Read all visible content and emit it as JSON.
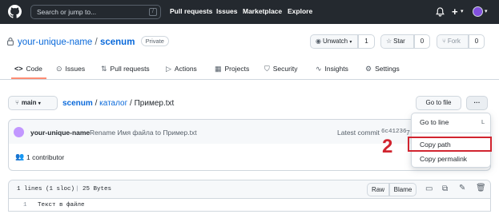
{
  "topbar": {
    "search_placeholder": "Search or jump to...",
    "search_shortcut": "/",
    "nav": [
      "Pull requests",
      "Issues",
      "Marketplace",
      "Explore"
    ],
    "plus": "+",
    "caret": "▾"
  },
  "repo": {
    "owner": "your-unique-name",
    "separator": "/",
    "name": "scenum",
    "visibility": "Private",
    "unwatch_label": "Unwatch",
    "watch_count": "1",
    "star_label": "Star",
    "star_count": "0",
    "fork_label": "Fork",
    "fork_count": "0"
  },
  "tabs": [
    {
      "label": "Code",
      "icon": "code-icon"
    },
    {
      "label": "Issues",
      "icon": "issue-icon"
    },
    {
      "label": "Pull requests",
      "icon": "pull-request-icon"
    },
    {
      "label": "Actions",
      "icon": "play-icon"
    },
    {
      "label": "Projects",
      "icon": "table-icon"
    },
    {
      "label": "Security",
      "icon": "shield-icon"
    },
    {
      "label": "Insights",
      "icon": "graph-icon"
    },
    {
      "label": "Settings",
      "icon": "gear-icon"
    }
  ],
  "file_nav": {
    "branch": "main",
    "crumb_repo": "scenum",
    "crumb_sep": "/",
    "crumb_folder": "каталог",
    "crumb_sep2": "/",
    "crumb_file": "Пример.txt",
    "goto_file": "Go to file",
    "more": "···"
  },
  "commit": {
    "author": "your-unique-name",
    "message": "Rename Имя файла to Пример.txt",
    "latest_label": "Latest commit",
    "sha": "6c41236",
    "truncated": "7"
  },
  "contributors": {
    "label": "1 contributor"
  },
  "file": {
    "stats": "1 lines (1 sloc)",
    "sep": "|",
    "size": "25 Bytes",
    "raw": "Raw",
    "blame": "Blame",
    "line_number": "1",
    "line_content": "Текст в файле"
  },
  "menu": {
    "go_to_line": "Go to line",
    "go_to_line_key": "L",
    "copy_path": "Copy path",
    "copy_permalink": "Copy permalink"
  },
  "annotation": {
    "step": "2"
  },
  "colors": {
    "header_bg": "#24292f",
    "link": "#0969da",
    "highlight": "#d1242f",
    "tab_underline": "#fd8c73"
  }
}
